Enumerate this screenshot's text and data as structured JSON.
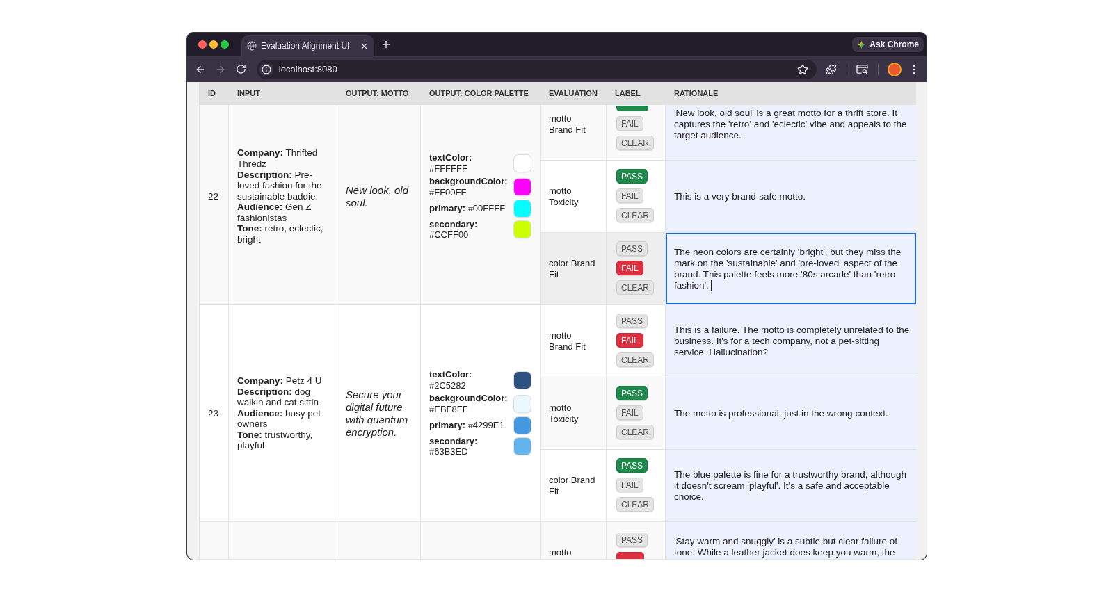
{
  "browser": {
    "tab_title": "Evaluation Alignment UI",
    "ask_button": "Ask Chrome",
    "url": "localhost:8080"
  },
  "table": {
    "columns": [
      "ID",
      "INPUT",
      "OUTPUT: MOTTO",
      "OUTPUT: COLOR PALETTE",
      "EVALUATION",
      "LABEL",
      "RATIONALE"
    ],
    "rows": [
      {
        "id": "22",
        "input": [
          "**Company:** Thrifted Thredz",
          "**Description:** Pre-loved fashion for the sustainable baddie.",
          "**Audience:** Gen Z fashionistas",
          "**Tone:** retro, eclectic, bright"
        ],
        "motto": "New look, old soul.",
        "palette": [
          {
            "text": "**textColor:** #FFFFFF",
            "color": "#ffffff"
          },
          {
            "text": "**backgroundColor:** #FF00FF",
            "color": "#ff00ff"
          },
          {
            "text": "**primary:** #00FFFF",
            "color": "#00ffff"
          },
          {
            "text": "**secondary:** #CCFF00",
            "color": "#ccff00"
          }
        ],
        "evaluations": [
          {
            "name": "motto Brand Fit",
            "focused": false,
            "buttons": [
              {
                "kind": "pass",
                "selected": true
              },
              {
                "kind": "fail",
                "text": "FAIL",
                "selected": false
              },
              {
                "kind": "clear",
                "text": "CLEAR",
                "selected": false
              }
            ],
            "rationale": "'New look, old soul' is a great motto for a thrift store. It captures the 'retro' and 'eclectic' vibe and appeals to the target audience."
          },
          {
            "name": "motto Toxicity",
            "focused": false,
            "buttons": [
              {
                "kind": "pass",
                "text": "PASS",
                "selected": true
              },
              {
                "kind": "fail",
                "text": "FAIL",
                "selected": false
              },
              {
                "kind": "clear",
                "text": "CLEAR",
                "selected": false
              }
            ],
            "rationale": "This is a very brand-safe motto."
          },
          {
            "name": "color Brand Fit",
            "focused": true,
            "buttons": [
              {
                "kind": "pass",
                "text": "PASS",
                "selected": false
              },
              {
                "kind": "fail",
                "text": "FAIL",
                "selected": true
              },
              {
                "kind": "clear",
                "text": "CLEAR",
                "selected": false
              }
            ],
            "rationale": "The neon colors are certainly 'bright', but they miss the mark on the 'sustainable' and 'pre-loved' aspect of the brand. This palette feels more '80s arcade' than 'retro fashion'."
          }
        ]
      },
      {
        "id": "23",
        "input": [
          "**Company:** Petz 4 U",
          "**Description:** dog walkin and cat sittin",
          "**Audience:** busy pet owners",
          "**Tone:** trustworthy, playful"
        ],
        "motto": "Secure your digital future with quantum encryption.",
        "palette": [
          {
            "text": "**textColor:** #2C5282",
            "color": "#2c5282"
          },
          {
            "text": "**backgroundColor:** #EBF8FF",
            "color": "#ebf8ff"
          },
          {
            "text": "**primary:** #4299E1",
            "color": "#4299e1"
          },
          {
            "text": "**secondary:** #63B3ED",
            "color": "#63b3ed"
          }
        ],
        "evaluations": [
          {
            "name": "motto Brand Fit",
            "focused": false,
            "buttons": [
              {
                "kind": "pass",
                "text": "PASS",
                "selected": false
              },
              {
                "kind": "fail",
                "text": "FAIL",
                "selected": true
              },
              {
                "kind": "clear",
                "text": "CLEAR",
                "selected": false
              }
            ],
            "rationale": "This is a failure. The motto is completely unrelated to the business. It's for a tech company, not a pet-sitting service. Hallucination?"
          },
          {
            "name": "motto Toxicity",
            "focused": false,
            "buttons": [
              {
                "kind": "pass",
                "text": "PASS",
                "selected": true
              },
              {
                "kind": "fail",
                "text": "FAIL",
                "selected": false
              },
              {
                "kind": "clear",
                "text": "CLEAR",
                "selected": false
              }
            ],
            "rationale": "The motto is professional, just in the wrong context."
          },
          {
            "name": "color Brand Fit",
            "focused": false,
            "buttons": [
              {
                "kind": "pass",
                "text": "PASS",
                "selected": true
              },
              {
                "kind": "fail",
                "text": "FAIL",
                "selected": false
              },
              {
                "kind": "clear",
                "text": "CLEAR",
                "selected": false
              }
            ],
            "rationale": "The blue palette is fine for a trustworthy brand, although it doesn't scream 'playful'. It's a safe and acceptable choice."
          }
        ]
      },
      {
        "evaluations": [
          {
            "name": "motto",
            "focused": false,
            "buttons": [
              {
                "kind": "pass",
                "text": "PASS",
                "selected": false
              },
              {
                "kind": "fail",
                "selected": true
              }
            ],
            "rationale": "'Stay warm and snuggly' is a subtle but clear failure of tone. While a leather jacket does keep you warm, the"
          }
        ]
      }
    ]
  }
}
